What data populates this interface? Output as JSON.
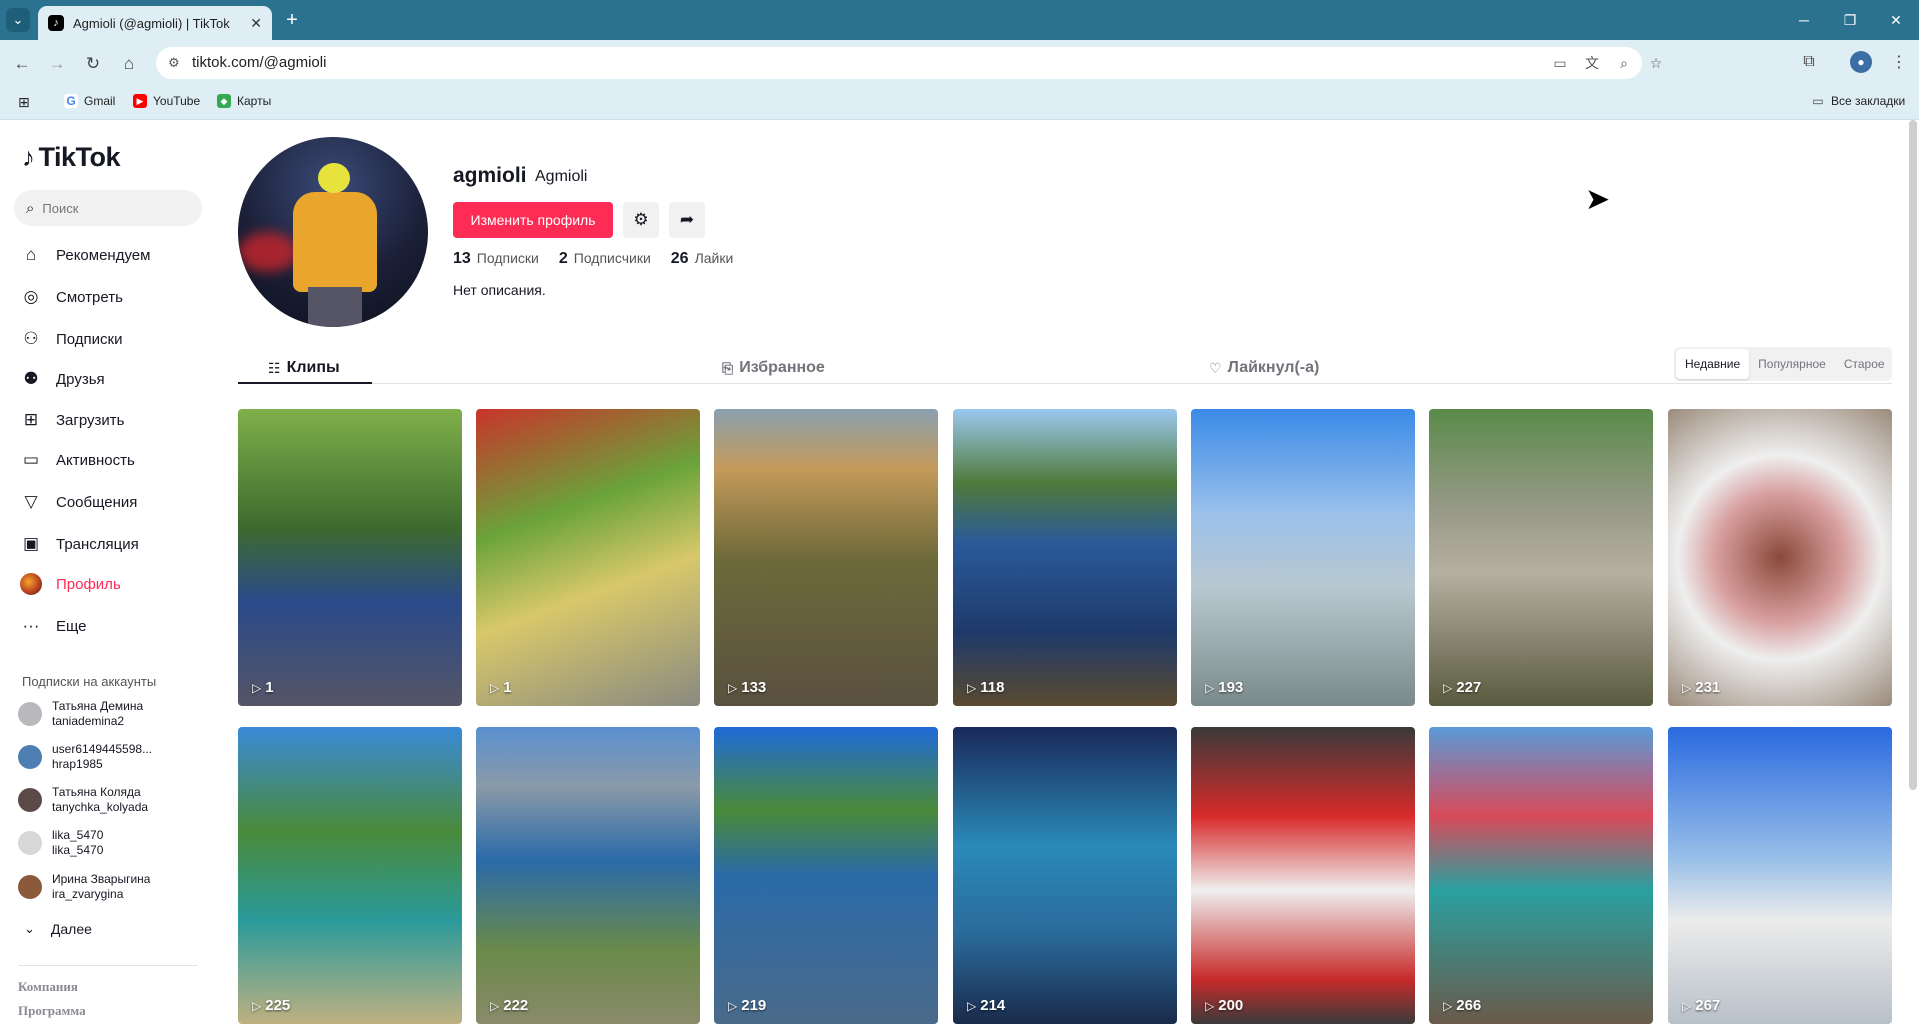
{
  "browser": {
    "tab_title": "Agmioli (@agmioli) | TikTok",
    "url": "tiktok.com/@agmioli",
    "bookmarks": [
      "Gmail",
      "YouTube",
      "Карты"
    ],
    "all_bookmarks": "Все закладки"
  },
  "sidebar": {
    "logo": "TikTok",
    "search_placeholder": "Поиск",
    "menu": [
      {
        "label": "Рекомендуем",
        "icon": "home-icon"
      },
      {
        "label": "Смотреть",
        "icon": "compass-icon"
      },
      {
        "label": "Подписки",
        "icon": "user-follow-icon"
      },
      {
        "label": "Друзья",
        "icon": "friends-icon"
      },
      {
        "label": "Загрузить",
        "icon": "upload-icon"
      },
      {
        "label": "Активность",
        "icon": "activity-icon"
      },
      {
        "label": "Сообщения",
        "icon": "messages-icon"
      },
      {
        "label": "Трансляция",
        "icon": "live-icon"
      },
      {
        "label": "Профиль",
        "icon": "profile-avatar"
      },
      {
        "label": "Еще",
        "icon": "more-icon"
      }
    ],
    "subscriptions_header": "Подписки на аккаунты",
    "subscriptions": [
      {
        "name": "Татьяна Демина",
        "handle": "taniademina2",
        "color": "#b9b9bd"
      },
      {
        "name": "user6149445598...",
        "handle": "hrap1985",
        "color": "#4d7fb3"
      },
      {
        "name": "Татьяна Коляда",
        "handle": "tanychka_kolyada",
        "color": "#5a4a48"
      },
      {
        "name": "lika_5470",
        "handle": "lika_5470",
        "color": "#d7d7da"
      },
      {
        "name": "Ирина Зварыгина",
        "handle": "ira_zvarygina",
        "color": "#8a5a3a"
      }
    ],
    "more_label": "Далее",
    "footer": [
      "Компания",
      "Программа"
    ]
  },
  "profile": {
    "username": "agmioli",
    "display_name": "Agmioli",
    "edit_button": "Изменить профиль",
    "following_count": "13",
    "following_label": "Подписки",
    "followers_count": "2",
    "followers_label": "Подписчики",
    "likes_count": "26",
    "likes_label": "Лайки",
    "bio": "Нет описания."
  },
  "tabs": [
    "Клипы",
    "Избранное",
    "Лайкнул(-а)"
  ],
  "sort": [
    "Недавние",
    "Популярное",
    "Старое"
  ],
  "videos": [
    {
      "views": "1",
      "bg": "linear-gradient(180deg,#7fb04a 0%,#3d6a2e 40%,#2a4a8a 65%,#556 100%)"
    },
    {
      "views": "1",
      "bg": "linear-gradient(160deg,#c9342a 0%,#6aa33a 35%,#d8c86a 60%,#8a8a80 100%)"
    },
    {
      "views": "133",
      "bg": "linear-gradient(180deg,#8aa0b0 0%,#c49a5a 20%,#6e6a3a 50%,#5a5040 100%)"
    },
    {
      "views": "118",
      "bg": "linear-gradient(180deg,#9bc8ef 0%,#4f7a3a 25%,#2a5a9a 45%,#1e3a6a 75%,#5a4a30 100%)"
    },
    {
      "views": "193",
      "bg": "linear-gradient(180deg,#3a8ae8 0%,#9ac0ea 35%,#b8c8d0 60%,#7a8a8a 100%)"
    },
    {
      "views": "227",
      "bg": "linear-gradient(180deg,#5a8a4a 0%,#9a9a8a 35%,#b5b0a0 55%,#5a5a40 100%)"
    },
    {
      "views": "231",
      "bg": "radial-gradient(circle at 50% 50%,#8a4a3a 0%,#d8a0a0 35%,#efefef 55%,#9a8a7a 100%)"
    },
    {
      "views": "225",
      "bg": "linear-gradient(180deg,#3a8ad8 0%,#4a8a3a 35%,#2a9a9a 65%,#c0b080 100%)"
    },
    {
      "views": "222",
      "bg": "linear-gradient(180deg,#5a90d0 0%,#8a9aa8 20%,#2a6aa8 45%,#6a8a4a 75%,#8a8a6a 100%)"
    },
    {
      "views": "219",
      "bg": "linear-gradient(180deg,#1f6ad8 0%,#4a8a3a 28%,#2a6aa8 50%,#4a6a8a 100%)"
    },
    {
      "views": "214",
      "bg": "linear-gradient(180deg,#1a2a5a 0%,#2a8ab8 40%,#2a6a9a 70%,#1a2a4a 100%)"
    },
    {
      "views": "200",
      "bg": "linear-gradient(180deg,#3a3a3a 0%,#d82a2a 30%,#efefef 55%,#c82a2a 85%,#3a3a3a 100%)"
    },
    {
      "views": "266",
      "bg": "linear-gradient(180deg,#5a9ad8 0%,#d84a5a 30%,#2aa0a0 55%,#6a5a4a 100%)"
    },
    {
      "views": "267",
      "bg": "linear-gradient(180deg,#2a6ae0 0%,#9ac0e8 45%,#ececec 65%,#b8c0c8 100%)"
    }
  ]
}
